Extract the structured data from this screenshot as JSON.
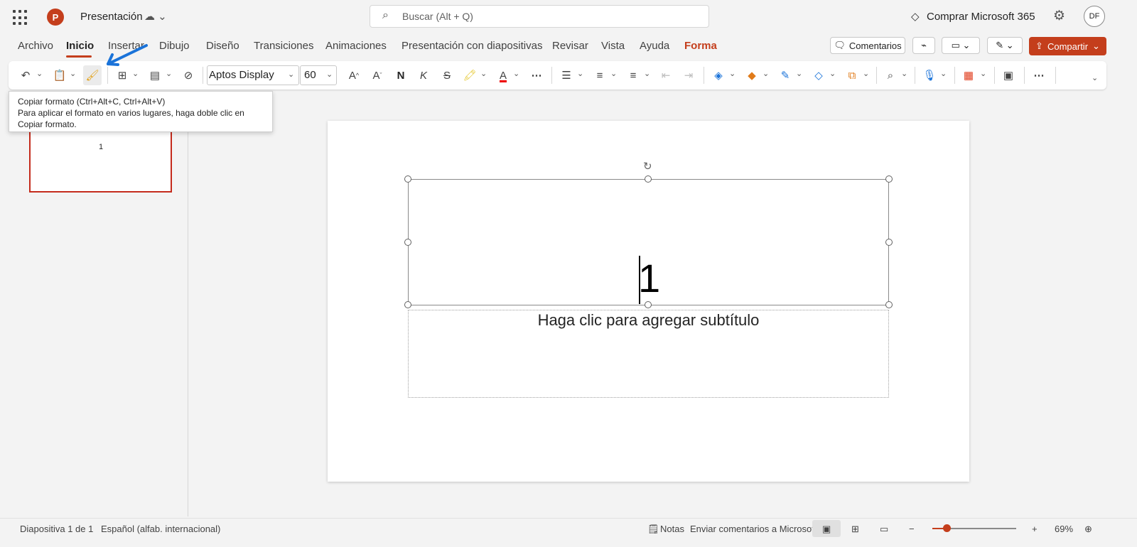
{
  "header": {
    "app_initial": "P",
    "doc_title": "Presentación",
    "search_placeholder": "Buscar (Alt + Q)",
    "buy_label": "Comprar Microsoft 365",
    "avatar_initials": "DF"
  },
  "tabs": [
    {
      "label": "Archivo"
    },
    {
      "label": "Inicio"
    },
    {
      "label": "Insertar"
    },
    {
      "label": "Dibujo"
    },
    {
      "label": "Diseño"
    },
    {
      "label": "Transiciones"
    },
    {
      "label": "Animaciones"
    },
    {
      "label": "Presentación con diapositivas"
    },
    {
      "label": "Revisar"
    },
    {
      "label": "Vista"
    },
    {
      "label": "Ayuda"
    },
    {
      "label": "Forma"
    }
  ],
  "actions": {
    "comments_label": "Comentarios",
    "share_label": "Compartir"
  },
  "toolbar": {
    "font_name": "Aptos Display",
    "font_size": "60",
    "bold_glyph": "N",
    "italic_glyph": "K",
    "strike_glyph": "S"
  },
  "tooltip": {
    "title": "Copiar formato (Ctrl+Alt+C, Ctrl+Alt+V)",
    "line1": "Para aplicar el formato en varios lugares, haga doble clic en",
    "line2": "Copiar formato."
  },
  "slides_pane": {
    "thumb_number": "1"
  },
  "slide": {
    "title_text": "1",
    "subtitle_placeholder": "Haga clic para agregar subtítulo"
  },
  "status": {
    "slide_counter": "Diapositiva 1 de 1",
    "language": "Español (alfab. internacional)",
    "notes_label": "Notas",
    "feedback_label": "Enviar comentarios a Microsoft",
    "zoom_level": "69%",
    "zoom_fraction": 0.17
  },
  "colors": {
    "accent": "#c43e1c",
    "annotation_arrow": "#1a73d9"
  }
}
